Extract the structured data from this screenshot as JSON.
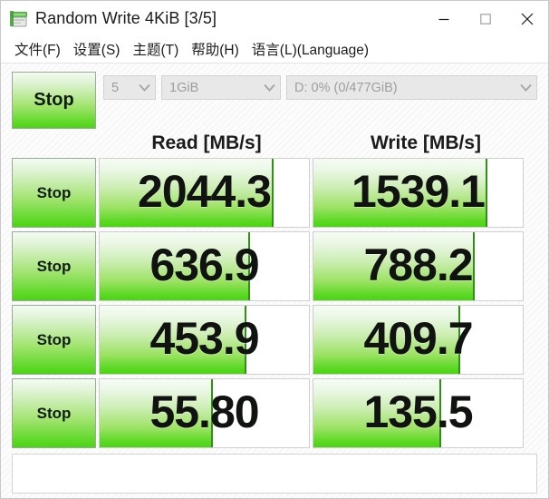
{
  "window": {
    "title": "Random Write 4KiB [3/5]",
    "icon": "disk-benchmark-icon",
    "controls": {
      "minimize": "—",
      "maximize": "□",
      "close": "✕"
    }
  },
  "menubar": {
    "items": [
      {
        "label": "文件(F)",
        "plain": "文件",
        "mnemonic": "F"
      },
      {
        "label": "设置(S)",
        "plain": "设置",
        "mnemonic": "S"
      },
      {
        "label": "主题(T)",
        "plain": "主题",
        "mnemonic": "T"
      },
      {
        "label": "帮助(H)",
        "plain": "帮助",
        "mnemonic": "H"
      },
      {
        "label": "语言(L)(Language)",
        "plain": "语言",
        "mnemonic": "L",
        "suffix": "(Language)"
      }
    ]
  },
  "toolbar": {
    "all_button_label": "Stop",
    "count": {
      "value": "5",
      "chevron": "chevron-down-icon"
    },
    "size": {
      "value": "1GiB",
      "chevron": "chevron-down-icon"
    },
    "drive": {
      "value": "D: 0% (0/477GiB)",
      "chevron": "chevron-down-icon"
    }
  },
  "columns": {
    "read": "Read [MB/s]",
    "write": "Write [MB/s]"
  },
  "rows": [
    {
      "button": "Stop",
      "read": {
        "value": "2044.3",
        "fill_percent": 83
      },
      "write": {
        "value": "1539.1",
        "fill_percent": 83
      }
    },
    {
      "button": "Stop",
      "read": {
        "value": "636.9",
        "fill_percent": 72
      },
      "write": {
        "value": "788.2",
        "fill_percent": 77
      }
    },
    {
      "button": "Stop",
      "read": {
        "value": "453.9",
        "fill_percent": 70
      },
      "write": {
        "value": "409.7",
        "fill_percent": 70
      }
    },
    {
      "button": "Stop",
      "read": {
        "value": "55.80",
        "fill_percent": 54
      },
      "write": {
        "value": "135.5",
        "fill_percent": 61
      }
    }
  ],
  "statusbar": {
    "text": ""
  },
  "colors": {
    "accent_green": "#49d510",
    "green_edge": "#2f8f16",
    "text": "#1b1b1b",
    "combo_text": "#9e9e9e",
    "close_hover": "#e81123"
  }
}
